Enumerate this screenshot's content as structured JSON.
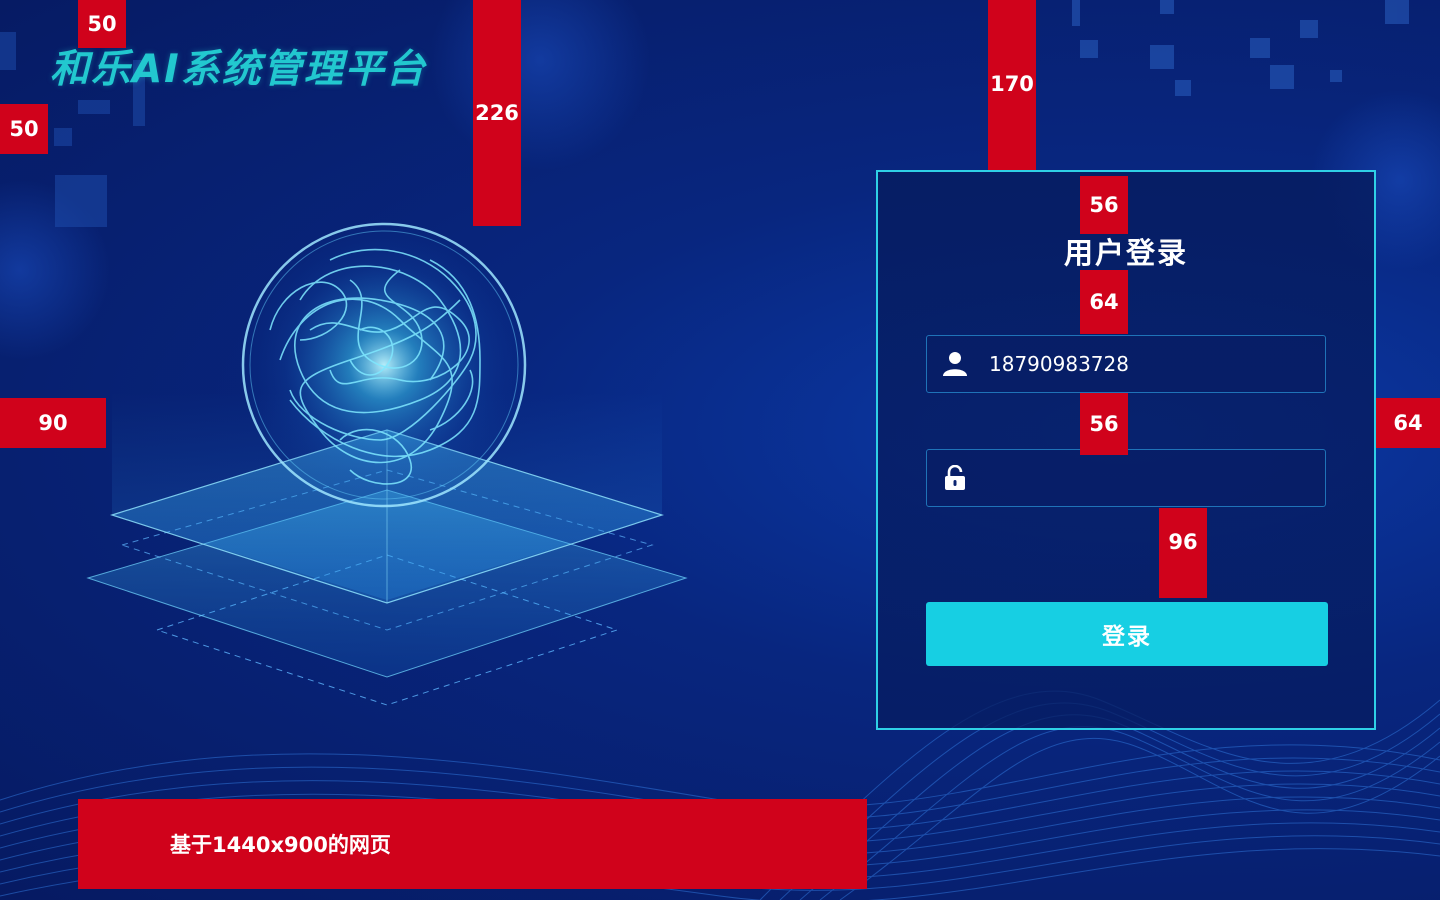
{
  "header": {
    "title": "和乐AI系统管理平台"
  },
  "annotations": {
    "title_top": "50",
    "title_left": "50",
    "title_gap": "226",
    "panel_top": "170",
    "panel_title_top": "56",
    "title_to_input": "64",
    "input_gap": "56",
    "input_to_button": "96",
    "illustration_left": "90",
    "panel_right": "64"
  },
  "footer": {
    "note": "基于1440x900的网页"
  },
  "login": {
    "title": "用户登录",
    "username_value": "18790983728",
    "password_value": "",
    "submit_label": "登录"
  },
  "icons": {
    "user": "user-icon",
    "password": "lock-icon"
  },
  "colors": {
    "accent": "#17cfe3",
    "annotation": "#d0021b",
    "panel_border": "#2fd0e6",
    "title": "#22c8cf"
  }
}
